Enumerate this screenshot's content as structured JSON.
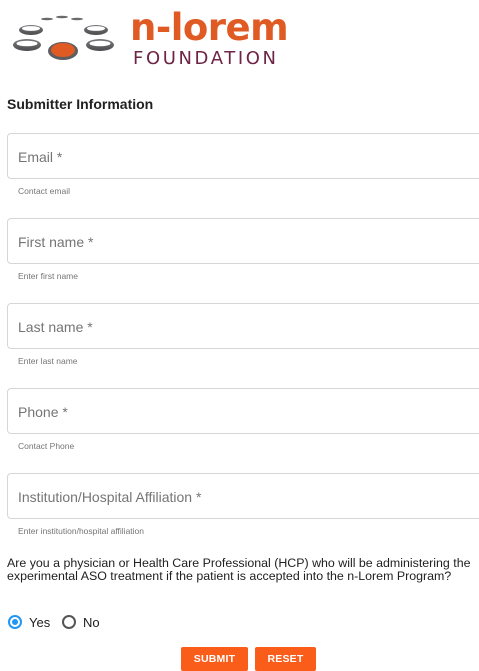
{
  "logo": {
    "name": "n-lorem",
    "subtitle": "FOUNDATION",
    "icon": "discs-logo-icon",
    "colors": {
      "accent": "#e05a24",
      "sub": "#6e2446",
      "disc": "#626265"
    }
  },
  "form": {
    "section_title": "Submitter Information",
    "fields": [
      {
        "placeholder": "Email *",
        "helper": "Contact email"
      },
      {
        "placeholder": "First name *",
        "helper": "Enter first name"
      },
      {
        "placeholder": "Last name *",
        "helper": "Enter last name"
      },
      {
        "placeholder": "Phone *",
        "helper": "Contact Phone"
      },
      {
        "placeholder": "Institution/Hospital Affiliation *",
        "helper": "Enter institution/hospital affiliation"
      }
    ],
    "question": "Are you a physician or Health Care Professional (HCP) who will be administering the experimental ASO treatment if the patient is accepted into the n-Lorem Program?",
    "options": [
      {
        "label": "Yes",
        "selected": true
      },
      {
        "label": "No",
        "selected": false
      }
    ],
    "submit_label": "SUBMIT",
    "reset_label": "RESET",
    "colors": {
      "button": "#fa5c1a",
      "radio_selected": "#2196f3"
    }
  }
}
